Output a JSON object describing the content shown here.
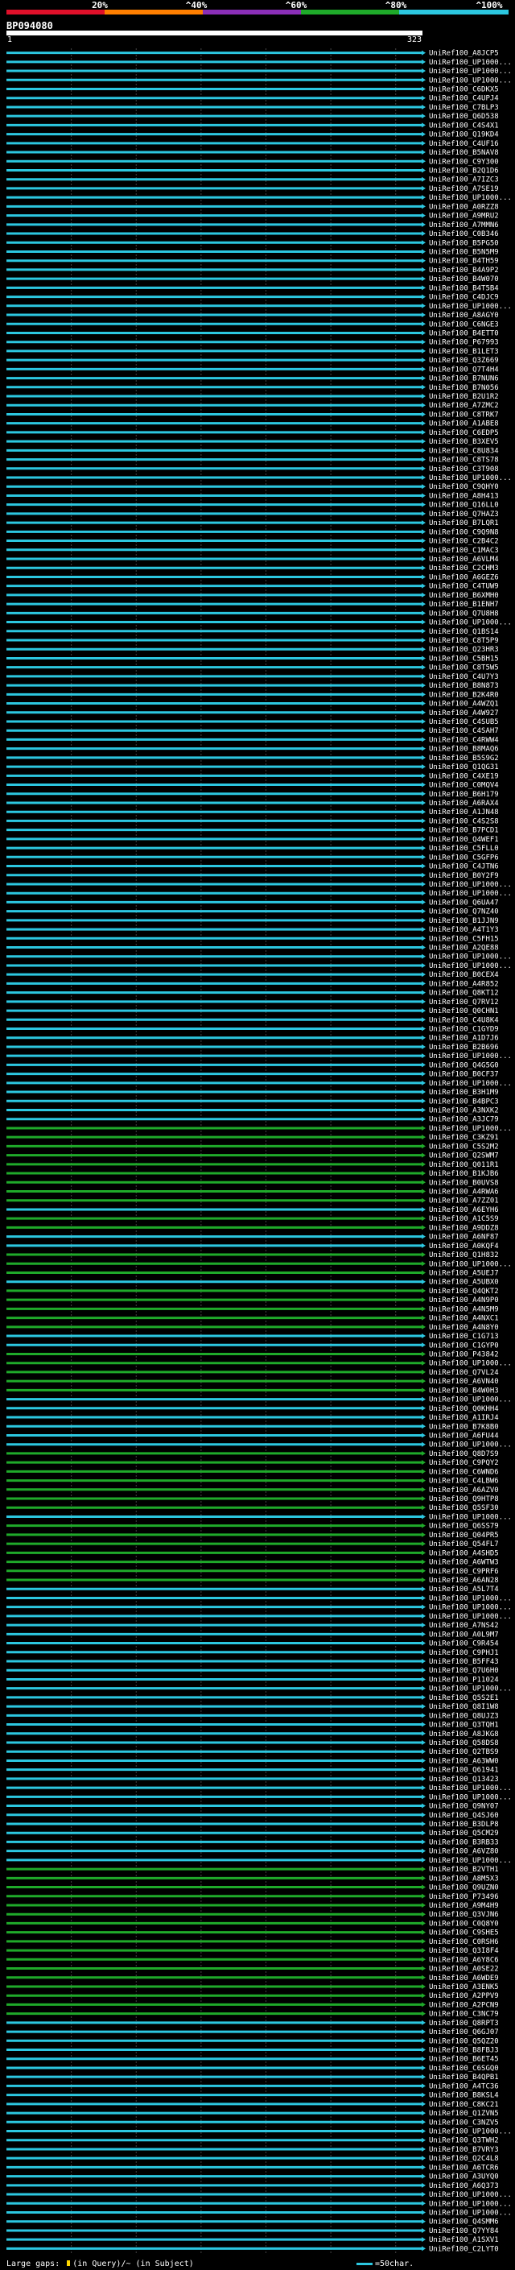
{
  "scale": {
    "labels": [
      "20%",
      "^40%",
      "^60%",
      "^80%",
      "^100%"
    ],
    "colors": [
      "#e0102a",
      "#ff7f00",
      "#8b2fb8",
      "#1faa2a",
      "#2cc7e0"
    ]
  },
  "query": {
    "id": "BP094080",
    "start": "1",
    "end": "323"
  },
  "footer": {
    "gaps_label": "Large gaps: ",
    "gap_query": "(in Query)/",
    "gap_subject": "~ (in Subject)",
    "legend_label": "=50char."
  },
  "chart_data": {
    "type": "alignment-overview",
    "query_length": 323,
    "x_range": [
      1,
      323
    ],
    "grid": true,
    "identity_colors": {
      "cyan": "#2cc7e0",
      "green": "#1faa2a"
    },
    "hits": [
      {
        "name": "UniRef100_A8JCP5",
        "color": "cyan"
      },
      {
        "name": "UniRef100_UP1000...",
        "color": "cyan"
      },
      {
        "name": "UniRef100_UP1000...",
        "color": "cyan"
      },
      {
        "name": "UniRef100_UP1000...",
        "color": "cyan"
      },
      {
        "name": "UniRef100_C6DKX5",
        "color": "cyan"
      },
      {
        "name": "UniRef100_C4UPJ4",
        "color": "cyan"
      },
      {
        "name": "UniRef100_C7BLP3",
        "color": "cyan"
      },
      {
        "name": "UniRef100_Q6D538",
        "color": "cyan"
      },
      {
        "name": "UniRef100_C4S4X1",
        "color": "cyan"
      },
      {
        "name": "UniRef100_Q19KD4",
        "color": "cyan"
      },
      {
        "name": "UniRef100_C4UF16",
        "color": "cyan"
      },
      {
        "name": "UniRef100_B5NAV8",
        "color": "cyan"
      },
      {
        "name": "UniRef100_C9Y300",
        "color": "cyan"
      },
      {
        "name": "UniRef100_B2Q1D6",
        "color": "cyan"
      },
      {
        "name": "UniRef100_A7IZC3",
        "color": "cyan"
      },
      {
        "name": "UniRef100_A7SE19",
        "color": "cyan"
      },
      {
        "name": "UniRef100_UP1000...",
        "color": "cyan"
      },
      {
        "name": "UniRef100_A0RZZ8",
        "color": "cyan"
      },
      {
        "name": "UniRef100_A9MRU2",
        "color": "cyan"
      },
      {
        "name": "UniRef100_A7MMN6",
        "color": "cyan"
      },
      {
        "name": "UniRef100_C0B346",
        "color": "cyan"
      },
      {
        "name": "UniRef100_B5PG50",
        "color": "cyan"
      },
      {
        "name": "UniRef100_B5N5M9",
        "color": "cyan"
      },
      {
        "name": "UniRef100_B4TH59",
        "color": "cyan"
      },
      {
        "name": "UniRef100_B4A9P2",
        "color": "cyan"
      },
      {
        "name": "UniRef100_B4W070",
        "color": "cyan"
      },
      {
        "name": "UniRef100_B4T5B4",
        "color": "cyan"
      },
      {
        "name": "UniRef100_C4DJC9",
        "color": "cyan"
      },
      {
        "name": "UniRef100_UP1000...",
        "color": "cyan"
      },
      {
        "name": "UniRef100_A8AGY0",
        "color": "cyan"
      },
      {
        "name": "UniRef100_C6NGE3",
        "color": "cyan"
      },
      {
        "name": "UniRef100_B4ETT0",
        "color": "cyan"
      },
      {
        "name": "UniRef100_P67993",
        "color": "cyan"
      },
      {
        "name": "UniRef100_B1LET3",
        "color": "cyan"
      },
      {
        "name": "UniRef100_Q3Z669",
        "color": "cyan"
      },
      {
        "name": "UniRef100_Q7T4H4",
        "color": "cyan"
      },
      {
        "name": "UniRef100_B7NUN6",
        "color": "cyan"
      },
      {
        "name": "UniRef100_B7N056",
        "color": "cyan"
      },
      {
        "name": "UniRef100_B2U1R2",
        "color": "cyan"
      },
      {
        "name": "UniRef100_A7ZMC2",
        "color": "cyan"
      },
      {
        "name": "UniRef100_C8TRK7",
        "color": "cyan"
      },
      {
        "name": "UniRef100_A1ABE8",
        "color": "cyan"
      },
      {
        "name": "UniRef100_C6EDP5",
        "color": "cyan"
      },
      {
        "name": "UniRef100_B3XEV5",
        "color": "cyan"
      },
      {
        "name": "UniRef100_C8U834",
        "color": "cyan"
      },
      {
        "name": "UniRef100_C8TS78",
        "color": "cyan"
      },
      {
        "name": "UniRef100_C3T908",
        "color": "cyan"
      },
      {
        "name": "UniRef100_UP1000...",
        "color": "cyan"
      },
      {
        "name": "UniRef100_C9QHY0",
        "color": "cyan"
      },
      {
        "name": "UniRef100_A8H413",
        "color": "cyan"
      },
      {
        "name": "UniRef100_Q16LL0",
        "color": "cyan"
      },
      {
        "name": "UniRef100_Q7HAZ3",
        "color": "cyan"
      },
      {
        "name": "UniRef100_B7LQR1",
        "color": "cyan"
      },
      {
        "name": "UniRef100_C9Q9N8",
        "color": "cyan"
      },
      {
        "name": "UniRef100_C2B4C2",
        "color": "cyan"
      },
      {
        "name": "UniRef100_C1MAC3",
        "color": "cyan"
      },
      {
        "name": "UniRef100_A6VLM4",
        "color": "cyan"
      },
      {
        "name": "UniRef100_C2CHM3",
        "color": "cyan"
      },
      {
        "name": "UniRef100_A6GEZ6",
        "color": "cyan"
      },
      {
        "name": "UniRef100_C4TUW9",
        "color": "cyan"
      },
      {
        "name": "UniRef100_B6XMH0",
        "color": "cyan"
      },
      {
        "name": "UniRef100_B1ENH7",
        "color": "cyan"
      },
      {
        "name": "UniRef100_Q7U8H8",
        "color": "cyan"
      },
      {
        "name": "UniRef100_UP1000...",
        "color": "cyan"
      },
      {
        "name": "UniRef100_Q1BS14",
        "color": "cyan"
      },
      {
        "name": "UniRef100_C8T5P9",
        "color": "cyan"
      },
      {
        "name": "UniRef100_Q23HR3",
        "color": "cyan"
      },
      {
        "name": "UniRef100_C5BH15",
        "color": "cyan"
      },
      {
        "name": "UniRef100_C8T5W5",
        "color": "cyan"
      },
      {
        "name": "UniRef100_C4U7Y3",
        "color": "cyan"
      },
      {
        "name": "UniRef100_B8N873",
        "color": "cyan"
      },
      {
        "name": "UniRef100_B2K4R0",
        "color": "cyan"
      },
      {
        "name": "UniRef100_A4WZQ1",
        "color": "cyan"
      },
      {
        "name": "UniRef100_A4W927",
        "color": "cyan"
      },
      {
        "name": "UniRef100_C4SUB5",
        "color": "cyan"
      },
      {
        "name": "UniRef100_C4SAH7",
        "color": "cyan"
      },
      {
        "name": "UniRef100_C4RWW4",
        "color": "cyan"
      },
      {
        "name": "UniRef100_B8MAQ6",
        "color": "cyan"
      },
      {
        "name": "UniRef100_B5S9G2",
        "color": "cyan"
      },
      {
        "name": "UniRef100_Q1QG31",
        "color": "cyan"
      },
      {
        "name": "UniRef100_C4XE19",
        "color": "cyan"
      },
      {
        "name": "UniRef100_C0MQV4",
        "color": "cyan"
      },
      {
        "name": "UniRef100_B6H179",
        "color": "cyan"
      },
      {
        "name": "UniRef100_A6RAX4",
        "color": "cyan"
      },
      {
        "name": "UniRef100_A1JN48",
        "color": "cyan"
      },
      {
        "name": "UniRef100_C4S2S8",
        "color": "cyan"
      },
      {
        "name": "UniRef100_B7PCD1",
        "color": "cyan"
      },
      {
        "name": "UniRef100_Q4WEF1",
        "color": "cyan"
      },
      {
        "name": "UniRef100_C5FLL0",
        "color": "cyan"
      },
      {
        "name": "UniRef100_C5GFP6",
        "color": "cyan"
      },
      {
        "name": "UniRef100_C4JTN6",
        "color": "cyan"
      },
      {
        "name": "UniRef100_B0Y2F9",
        "color": "cyan"
      },
      {
        "name": "UniRef100_UP1000...",
        "color": "cyan"
      },
      {
        "name": "UniRef100_UP1000...",
        "color": "cyan"
      },
      {
        "name": "UniRef100_Q6UA47",
        "color": "cyan"
      },
      {
        "name": "UniRef100_Q7NZ40",
        "color": "cyan"
      },
      {
        "name": "UniRef100_B1JJN9",
        "color": "cyan"
      },
      {
        "name": "UniRef100_A4T1Y3",
        "color": "cyan"
      },
      {
        "name": "UniRef100_C5FH15",
        "color": "cyan"
      },
      {
        "name": "UniRef100_A2QE88",
        "color": "cyan"
      },
      {
        "name": "UniRef100_UP1000...",
        "color": "cyan"
      },
      {
        "name": "UniRef100_UP1000...",
        "color": "cyan"
      },
      {
        "name": "UniRef100_B0CEX4",
        "color": "cyan"
      },
      {
        "name": "UniRef100_A4R852",
        "color": "cyan"
      },
      {
        "name": "UniRef100_Q8KT12",
        "color": "cyan"
      },
      {
        "name": "UniRef100_Q7RV12",
        "color": "cyan"
      },
      {
        "name": "UniRef100_Q0CHN1",
        "color": "cyan"
      },
      {
        "name": "UniRef100_C4U8K4",
        "color": "cyan"
      },
      {
        "name": "UniRef100_C1GYD9",
        "color": "cyan"
      },
      {
        "name": "UniRef100_A1D7J6",
        "color": "cyan"
      },
      {
        "name": "UniRef100_B2B696",
        "color": "cyan"
      },
      {
        "name": "UniRef100_UP1000...",
        "color": "cyan"
      },
      {
        "name": "UniRef100_Q4G5G0",
        "color": "cyan"
      },
      {
        "name": "UniRef100_B0CF37",
        "color": "cyan"
      },
      {
        "name": "UniRef100_UP1000...",
        "color": "cyan"
      },
      {
        "name": "UniRef100_B3H1M9",
        "color": "cyan"
      },
      {
        "name": "UniRef100_B4BPC3",
        "color": "cyan"
      },
      {
        "name": "UniRef100_A3NXK2",
        "color": "cyan"
      },
      {
        "name": "UniRef100_A3JC79",
        "color": "cyan"
      },
      {
        "name": "UniRef100_UP1000...",
        "color": "green"
      },
      {
        "name": "UniRef100_C3KZ91",
        "color": "green"
      },
      {
        "name": "UniRef100_C5S2M2",
        "color": "green"
      },
      {
        "name": "UniRef100_Q2SWM7",
        "color": "green"
      },
      {
        "name": "UniRef100_Q011R1",
        "color": "green"
      },
      {
        "name": "UniRef100_B1KJB6",
        "color": "green"
      },
      {
        "name": "UniRef100_B0UVS8",
        "color": "green"
      },
      {
        "name": "UniRef100_A4RWA6",
        "color": "green"
      },
      {
        "name": "UniRef100_A7ZZ01",
        "color": "green"
      },
      {
        "name": "UniRef100_A6EYH6",
        "color": "cyan"
      },
      {
        "name": "UniRef100_A1C5S9",
        "color": "green"
      },
      {
        "name": "UniRef100_A9DDZ8",
        "color": "green"
      },
      {
        "name": "UniRef100_A6NF87",
        "color": "cyan"
      },
      {
        "name": "UniRef100_A0KQF4",
        "color": "cyan"
      },
      {
        "name": "UniRef100_Q1H832",
        "color": "green"
      },
      {
        "name": "UniRef100_UP1000...",
        "color": "green"
      },
      {
        "name": "UniRef100_A5UEJ7",
        "color": "green"
      },
      {
        "name": "UniRef100_A5UBX0",
        "color": "cyan"
      },
      {
        "name": "UniRef100_Q4QKT2",
        "color": "green"
      },
      {
        "name": "UniRef100_A4N9P0",
        "color": "green"
      },
      {
        "name": "UniRef100_A4N5M9",
        "color": "green"
      },
      {
        "name": "UniRef100_A4NXC1",
        "color": "green"
      },
      {
        "name": "UniRef100_A4N8Y0",
        "color": "green"
      },
      {
        "name": "UniRef100_C1G713",
        "color": "cyan"
      },
      {
        "name": "UniRef100_C1GYP0",
        "color": "cyan"
      },
      {
        "name": "UniRef100_P43842",
        "color": "green"
      },
      {
        "name": "UniRef100_UP1000...",
        "color": "green"
      },
      {
        "name": "UniRef100_Q7VL24",
        "color": "green"
      },
      {
        "name": "UniRef100_A6VN40",
        "color": "green"
      },
      {
        "name": "UniRef100_B4W0H3",
        "color": "green"
      },
      {
        "name": "UniRef100_UP1000...",
        "color": "cyan"
      },
      {
        "name": "UniRef100_Q0KHH4",
        "color": "cyan"
      },
      {
        "name": "UniRef100_A1IRJ4",
        "color": "cyan"
      },
      {
        "name": "UniRef100_B7K8B0",
        "color": "cyan"
      },
      {
        "name": "UniRef100_A6FU44",
        "color": "cyan"
      },
      {
        "name": "UniRef100_UP1000...",
        "color": "cyan"
      },
      {
        "name": "UniRef100_Q8D7S9",
        "color": "green"
      },
      {
        "name": "UniRef100_C9PQY2",
        "color": "green"
      },
      {
        "name": "UniRef100_C6WND6",
        "color": "green"
      },
      {
        "name": "UniRef100_C4LBW6",
        "color": "green"
      },
      {
        "name": "UniRef100_A6AZV0",
        "color": "green"
      },
      {
        "name": "UniRef100_Q9HTP8",
        "color": "green"
      },
      {
        "name": "UniRef100_Q5SF30",
        "color": "green"
      },
      {
        "name": "UniRef100_UP1000...",
        "color": "cyan"
      },
      {
        "name": "UniRef100_Q6SS79",
        "color": "green"
      },
      {
        "name": "UniRef100_Q04PR5",
        "color": "green"
      },
      {
        "name": "UniRef100_Q54FL7",
        "color": "green"
      },
      {
        "name": "UniRef100_A4SHD5",
        "color": "green"
      },
      {
        "name": "UniRef100_A6WTW3",
        "color": "green"
      },
      {
        "name": "UniRef100_C9PRF6",
        "color": "green"
      },
      {
        "name": "UniRef100_A6AN28",
        "color": "green"
      },
      {
        "name": "UniRef100_A5L7T4",
        "color": "cyan"
      },
      {
        "name": "UniRef100_UP1000...",
        "color": "cyan"
      },
      {
        "name": "UniRef100_UP1000...",
        "color": "cyan"
      },
      {
        "name": "UniRef100_UP1000...",
        "color": "cyan"
      },
      {
        "name": "UniRef100_A7NS42",
        "color": "cyan"
      },
      {
        "name": "UniRef100_A0L9M7",
        "color": "cyan"
      },
      {
        "name": "UniRef100_C9R454",
        "color": "cyan"
      },
      {
        "name": "UniRef100_C9PHJ1",
        "color": "cyan"
      },
      {
        "name": "UniRef100_B5FF43",
        "color": "cyan"
      },
      {
        "name": "UniRef100_Q7U6H0",
        "color": "cyan"
      },
      {
        "name": "UniRef100_P11024",
        "color": "cyan"
      },
      {
        "name": "UniRef100_UP1000...",
        "color": "cyan"
      },
      {
        "name": "UniRef100_Q5S2E1",
        "color": "cyan"
      },
      {
        "name": "UniRef100_Q8I1W8",
        "color": "cyan"
      },
      {
        "name": "UniRef100_Q8UJZ3",
        "color": "cyan"
      },
      {
        "name": "UniRef100_Q3TQH1",
        "color": "cyan"
      },
      {
        "name": "UniRef100_A8JKG8",
        "color": "cyan"
      },
      {
        "name": "UniRef100_Q58DS8",
        "color": "cyan"
      },
      {
        "name": "UniRef100_Q2TBS9",
        "color": "cyan"
      },
      {
        "name": "UniRef100_A63WW0",
        "color": "cyan"
      },
      {
        "name": "UniRef100_Q61941",
        "color": "cyan"
      },
      {
        "name": "UniRef100_Q13423",
        "color": "cyan"
      },
      {
        "name": "UniRef100_UP1000...",
        "color": "cyan"
      },
      {
        "name": "UniRef100_UP1000...",
        "color": "cyan"
      },
      {
        "name": "UniRef100_Q9NY07",
        "color": "cyan"
      },
      {
        "name": "UniRef100_Q4SJ60",
        "color": "cyan"
      },
      {
        "name": "UniRef100_B3DLP8",
        "color": "cyan"
      },
      {
        "name": "UniRef100_Q5CM29",
        "color": "cyan"
      },
      {
        "name": "UniRef100_B3RB33",
        "color": "cyan"
      },
      {
        "name": "UniRef100_A6VZ80",
        "color": "cyan"
      },
      {
        "name": "UniRef100_UP1000...",
        "color": "cyan"
      },
      {
        "name": "UniRef100_B2VTH1",
        "color": "green"
      },
      {
        "name": "UniRef100_A8M5X3",
        "color": "green"
      },
      {
        "name": "UniRef100_Q9UZN0",
        "color": "green"
      },
      {
        "name": "UniRef100_P73496",
        "color": "green"
      },
      {
        "name": "UniRef100_A9M4H9",
        "color": "green"
      },
      {
        "name": "UniRef100_Q3VJN6",
        "color": "green"
      },
      {
        "name": "UniRef100_C0Q8Y0",
        "color": "green"
      },
      {
        "name": "UniRef100_C9SHE5",
        "color": "green"
      },
      {
        "name": "UniRef100_C0RSH6",
        "color": "green"
      },
      {
        "name": "UniRef100_Q3I8F4",
        "color": "green"
      },
      {
        "name": "UniRef100_A6Y8C6",
        "color": "green"
      },
      {
        "name": "UniRef100_A0SE22",
        "color": "green"
      },
      {
        "name": "UniRef100_A6WDE9",
        "color": "green"
      },
      {
        "name": "UniRef100_A3ENK5",
        "color": "green"
      },
      {
        "name": "UniRef100_A2PPV9",
        "color": "green"
      },
      {
        "name": "UniRef100_A2PCN9",
        "color": "green"
      },
      {
        "name": "UniRef100_C3NC79",
        "color": "green"
      },
      {
        "name": "UniRef100_Q8RPT3",
        "color": "cyan"
      },
      {
        "name": "UniRef100_Q6GJ07",
        "color": "cyan"
      },
      {
        "name": "UniRef100_Q5QZ20",
        "color": "cyan"
      },
      {
        "name": "UniRef100_B8FBJ3",
        "color": "cyan"
      },
      {
        "name": "UniRef100_B6ET45",
        "color": "cyan"
      },
      {
        "name": "UniRef100_C6SGQ0",
        "color": "cyan"
      },
      {
        "name": "UniRef100_B4QPB1",
        "color": "cyan"
      },
      {
        "name": "UniRef100_A4TC36",
        "color": "cyan"
      },
      {
        "name": "UniRef100_B8KSL4",
        "color": "cyan"
      },
      {
        "name": "UniRef100_C8KC21",
        "color": "cyan"
      },
      {
        "name": "UniRef100_Q1ZVN5",
        "color": "cyan"
      },
      {
        "name": "UniRef100_C3NZV5",
        "color": "cyan"
      },
      {
        "name": "UniRef100_UP1000...",
        "color": "cyan"
      },
      {
        "name": "UniRef100_Q3TWH2",
        "color": "cyan"
      },
      {
        "name": "UniRef100_B7VRY3",
        "color": "cyan"
      },
      {
        "name": "UniRef100_Q2C4L8",
        "color": "cyan"
      },
      {
        "name": "UniRef100_A6TCR6",
        "color": "cyan"
      },
      {
        "name": "UniRef100_A3UYQ0",
        "color": "cyan"
      },
      {
        "name": "UniRef100_A6Q373",
        "color": "cyan"
      },
      {
        "name": "UniRef100_UP1000...",
        "color": "cyan"
      },
      {
        "name": "UniRef100_UP1000...",
        "color": "cyan"
      },
      {
        "name": "UniRef100_UP1000...",
        "color": "cyan"
      },
      {
        "name": "UniRef100_Q4SMM6",
        "color": "cyan"
      },
      {
        "name": "UniRef100_Q7YY84",
        "color": "cyan"
      },
      {
        "name": "UniRef100_A1SXV1",
        "color": "cyan"
      },
      {
        "name": "UniRef100_C2LYT0",
        "color": "cyan"
      }
    ]
  }
}
